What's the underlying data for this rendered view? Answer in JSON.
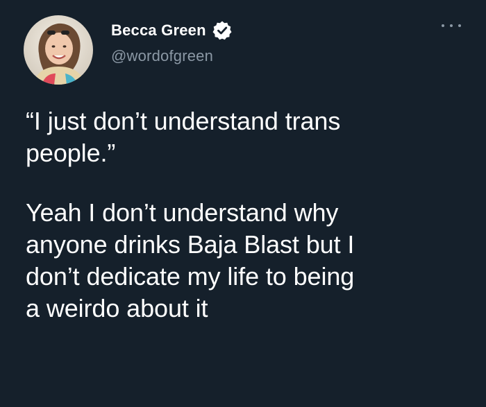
{
  "author": {
    "display_name": "Becca Green",
    "handle": "@wordofgreen",
    "verified_icon": "verified-badge-icon",
    "avatar": "profile-photo"
  },
  "menu": {
    "icon": "more-options-icon"
  },
  "tweet": {
    "paragraph_1": {
      "line_1": "“I just don’t understand trans",
      "line_2": "people.”"
    },
    "paragraph_2": {
      "line_1": "Yeah I don’t understand why",
      "line_2": "anyone drinks Baja Blast but I",
      "line_3": "don’t dedicate my life to being",
      "line_4": "a weirdo about it"
    }
  },
  "colors": {
    "background": "#15202b",
    "text_primary": "#ffffff",
    "text_secondary": "#8b98a5",
    "verified": "#1d9bf0"
  }
}
